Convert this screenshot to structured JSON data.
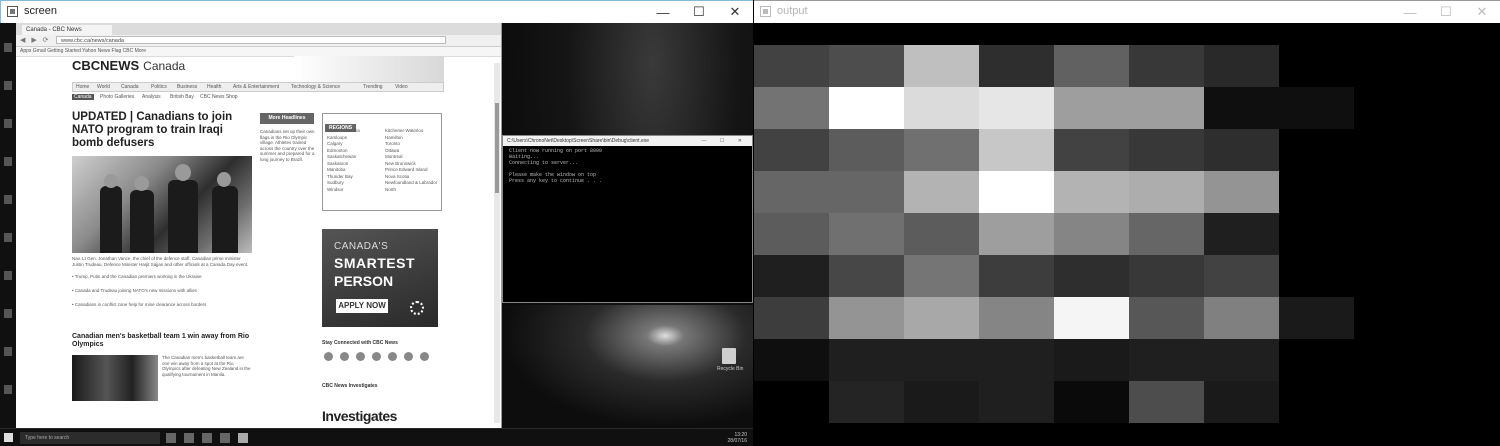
{
  "windows": {
    "left": {
      "title": "screen",
      "buttons": {
        "minimize": "—",
        "maximize": "☐",
        "close": "✕"
      }
    },
    "right": {
      "title": "output",
      "buttons": {
        "minimize": "—",
        "maximize": "☐",
        "close": "✕"
      }
    }
  },
  "browser": {
    "tab": "Canada - CBC News",
    "url": "www.cbc.ca/news/canada",
    "nav": "◀ ▶ ⟳",
    "bookmarks": "Apps   Gmail   Getting Started   Yahoo   News   Flag   CBC   More"
  },
  "cbc": {
    "logo": "CBCNEWS",
    "section": "Canada",
    "nav": [
      "Home",
      "World",
      "Canada",
      "Politics",
      "Business",
      "Health",
      "Arts & Entertainment",
      "Technology & Science",
      "Trending",
      "Video"
    ],
    "subnav": [
      "Canada",
      "Photo Galleries",
      "Analysis",
      "British Bay",
      "CBC News Shop"
    ],
    "headline": "UPDATED | Canadians to join NATO program to train Iraqi bomb defusers",
    "caption": "Nav. Lt Gen. Jonathan Vance, the chief of the defence staff, Canadian prime minister Justin Trudeau, Defence Minister Harjit Sajjan and other officials at a Canada Day event.",
    "bullets": [
      "• Trump, Putin and the Canadian premiers working in the Ukraine",
      "• Canada and Trudeau joining NATO's new missions with allies",
      "• Canadians in conflict zone help for mine clearance across borders"
    ],
    "story2_title": "Canadian men's basketball team 1 win away from Rio Olympics",
    "story2_text": "The Canadian men's basketball team are one win away from a spot at the Rio Olympics after defeating New Zealand in the qualifying tournament in Manila.",
    "more_headlines": "More Headlines",
    "mid_text": "Canadians set up their own flags in the Rio Olympic village. Athletes trained across the country over the summer and prepared for a long journey to Brazil.",
    "regions_title": "REGIONS",
    "regions_left": [
      "British Columbia",
      "Kamloops",
      "Calgary",
      "Edmonton",
      "Saskatchewan",
      "Saskatoon",
      "Manitoba",
      "Thunder Bay",
      "Sudbury",
      "Windsor"
    ],
    "regions_right": [
      "Kitchener-Waterloo",
      "Hamilton",
      "Toronto",
      "Ottawa",
      "Montreal",
      "New Brunswick",
      "Prince Edward Island",
      "Nova Scotia",
      "Newfoundland & Labrador",
      "North"
    ],
    "ad": {
      "line1": "CANADA'S",
      "line2": "SMARTEST",
      "line3": "PERSON",
      "button": "APPLY NOW"
    },
    "stay_connected": "Stay Connected with CBC News",
    "investigates_label": "CBC News Investigates",
    "investigates_big": "Investigates"
  },
  "console": {
    "title": "C:\\Users\\ChronoNet\\Desktop\\ScreenShare\\bin\\Debug\\client.exe",
    "lines": [
      "Client now running on port 8000",
      "Waiting...",
      "Connecting to server...",
      "",
      "Please make the window on top",
      "Press any key to continue . . ."
    ],
    "buttons": "— ☐ ✕"
  },
  "desktop": {
    "recycle_label": "Recycle Bin"
  },
  "taskbar": {
    "search": "Type here to search",
    "tray_time": "13:20",
    "tray_date": "28/07/16"
  },
  "output": {
    "grid": [
      [
        0.26,
        0.3,
        0.75,
        0.18,
        0.38,
        0.22,
        0.16,
        0.0,
        0.0
      ],
      [
        0.45,
        1.0,
        0.86,
        0.9,
        0.62,
        0.62,
        0.06,
        0.06,
        0.0
      ],
      [
        0.26,
        0.36,
        0.44,
        0.78,
        0.26,
        0.22,
        0.18,
        0.0,
        0.0
      ],
      [
        0.4,
        0.4,
        0.7,
        1.0,
        0.7,
        0.68,
        0.58,
        0.0,
        0.0
      ],
      [
        0.36,
        0.44,
        0.36,
        0.62,
        0.52,
        0.4,
        0.12,
        0.0,
        0.0
      ],
      [
        0.12,
        0.28,
        0.46,
        0.24,
        0.18,
        0.22,
        0.26,
        0.0,
        0.0
      ],
      [
        0.24,
        0.58,
        0.66,
        0.52,
        0.96,
        0.34,
        0.5,
        0.1,
        0.0
      ],
      [
        0.06,
        0.12,
        0.12,
        0.12,
        0.1,
        0.12,
        0.12,
        0.0,
        0.0
      ],
      [
        0.0,
        0.14,
        0.1,
        0.12,
        0.04,
        0.3,
        0.1,
        0.0,
        0.0
      ],
      [
        0.0,
        0.0,
        0.0,
        0.0,
        0.0,
        0.0,
        0.0,
        0.0,
        0.0
      ]
    ]
  }
}
